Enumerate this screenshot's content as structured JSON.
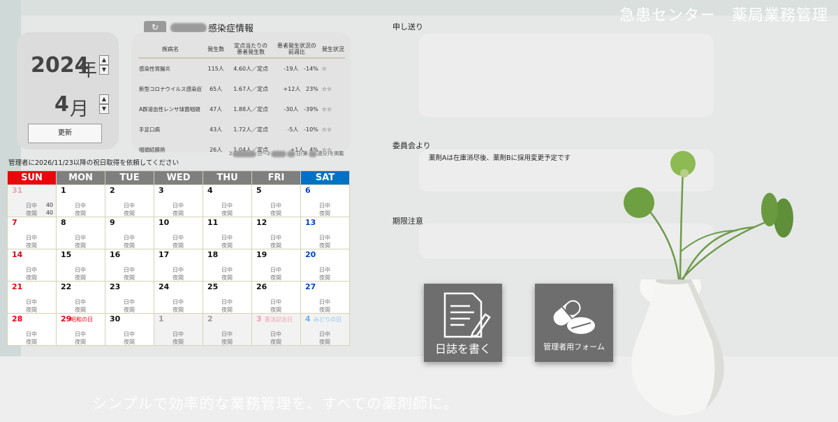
{
  "app": {
    "title": "急患センター　薬局業務管理",
    "tagline": "シンプルで効率的な業務管理を、すべての薬剤師に。"
  },
  "date_selector": {
    "year": "2024",
    "year_unit": "年",
    "month": "4",
    "month_unit": "月",
    "update_label": "更新"
  },
  "infection": {
    "title_suffix": "感染症情報",
    "refresh_icon": "refresh-icon",
    "headers": [
      "疾病名",
      "発生数",
      "定点当たりの\n患者発生数",
      "患者発生状況の\n前週比",
      "発生状況"
    ],
    "rows": [
      {
        "name": "感染性胃腸炎",
        "count": "115人",
        "per_point": "4.60人／定点",
        "diff": "-19人",
        "pct": "-14%",
        "stars": "☆"
      },
      {
        "name": "新型コロナウイルス感染症",
        "count": "65人",
        "per_point": "1.67人／定点",
        "diff": "+12人",
        "pct": "23%",
        "stars": "☆☆"
      },
      {
        "name": "A群溶血性レンサ球菌咽頭",
        "count": "47人",
        "per_point": "1.88人／定点",
        "diff": "-30人",
        "pct": "-39%",
        "stars": "☆☆"
      },
      {
        "name": "手足口病",
        "count": "43人",
        "per_point": "1.72人／定点",
        "diff": "-5人",
        "pct": "-10%",
        "stars": "☆☆"
      },
      {
        "name": "咽頭結膜熱",
        "count": "26人",
        "per_point": "1.04人／定点",
        "diff": "+1人",
        "pct": "4%",
        "stars": "☆☆"
      }
    ],
    "source_a": "2",
    "source_b": "日～2",
    "source_c": "日(第",
    "source_d": "週分)を掲載"
  },
  "calendar": {
    "notice": "管理者に2026/11/23以降の祝日取得を依頼してください",
    "weekdays": [
      "SUN",
      "MON",
      "TUE",
      "WED",
      "THU",
      "FRI",
      "SAT"
    ],
    "shift_day": "日中",
    "shift_night": "夜間",
    "weeks": [
      [
        {
          "d": "31",
          "c": "pink",
          "shade": true,
          "n1": "40",
          "n2": "40"
        },
        {
          "d": "1"
        },
        {
          "d": "2"
        },
        {
          "d": "3"
        },
        {
          "d": "4"
        },
        {
          "d": "5"
        },
        {
          "d": "6",
          "c": "blue"
        }
      ],
      [
        {
          "d": "7",
          "c": "red"
        },
        {
          "d": "8"
        },
        {
          "d": "9"
        },
        {
          "d": "10"
        },
        {
          "d": "11"
        },
        {
          "d": "12"
        },
        {
          "d": "13",
          "c": "blue"
        }
      ],
      [
        {
          "d": "14",
          "c": "red"
        },
        {
          "d": "15"
        },
        {
          "d": "16"
        },
        {
          "d": "17"
        },
        {
          "d": "18"
        },
        {
          "d": "19"
        },
        {
          "d": "20",
          "c": "blue"
        }
      ],
      [
        {
          "d": "21",
          "c": "red"
        },
        {
          "d": "22"
        },
        {
          "d": "23"
        },
        {
          "d": "24"
        },
        {
          "d": "25"
        },
        {
          "d": "26"
        },
        {
          "d": "27",
          "c": "blue"
        }
      ],
      [
        {
          "d": "28",
          "c": "red"
        },
        {
          "d": "29",
          "c": "red",
          "h": "昭和の日"
        },
        {
          "d": "30"
        },
        {
          "d": "1",
          "c": "gray",
          "shade": true
        },
        {
          "d": "2",
          "c": "gray",
          "shade": true
        },
        {
          "d": "3",
          "c": "pink",
          "shade": true,
          "h": "憲法記念日",
          "hc": "pink"
        },
        {
          "d": "4",
          "c": "lblue",
          "shade": true,
          "h": "みどりの日",
          "hc": "lblue"
        }
      ]
    ]
  },
  "sections": {
    "handover_label": "申し送り",
    "committee_label": "委員会より",
    "committee_text": "薬剤Aは在庫消尽後、薬剤Bに採用変更予定です",
    "expiry_label": "期限注意"
  },
  "tiles": {
    "diary_label": "日誌を書く",
    "admin_label": "管理者用フォーム"
  }
}
